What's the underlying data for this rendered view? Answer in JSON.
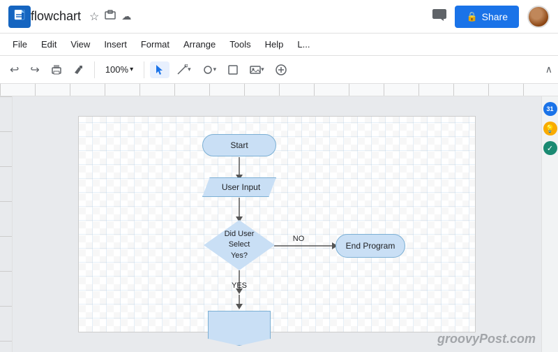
{
  "app": {
    "icon": "G",
    "title": "flowchart",
    "star_icon": "☆",
    "drive_icon": "⬜",
    "cloud_icon": "☁"
  },
  "header": {
    "share_label": "Share",
    "share_icon": "🔒",
    "comment_icon": "💬"
  },
  "menu": {
    "items": [
      "File",
      "Edit",
      "View",
      "Insert",
      "Format",
      "Arrange",
      "Tools",
      "Help",
      "L..."
    ]
  },
  "toolbar": {
    "undo_label": "↩",
    "redo_label": "↪",
    "print_label": "🖨",
    "format_paint_label": "🖌",
    "zoom_value": "100%",
    "zoom_arrow": "▾",
    "select_icon": "↖",
    "line_icon": "╱",
    "shape_icon": "⬭",
    "insert_icon": "⬜",
    "image_icon": "🖼",
    "add_icon": "+"
  },
  "flowchart": {
    "start_label": "Start",
    "input_label": "User Input",
    "decision_label": "Did User\nSelect\nYes?",
    "end_label": "End Program",
    "yes_label": "YES",
    "no_label": "NO",
    "box5_label": ""
  },
  "side_panel": {
    "calendar_icon": "31",
    "bulb_icon": "💡",
    "check_icon": "✓"
  },
  "watermark": "groovyPost.com"
}
